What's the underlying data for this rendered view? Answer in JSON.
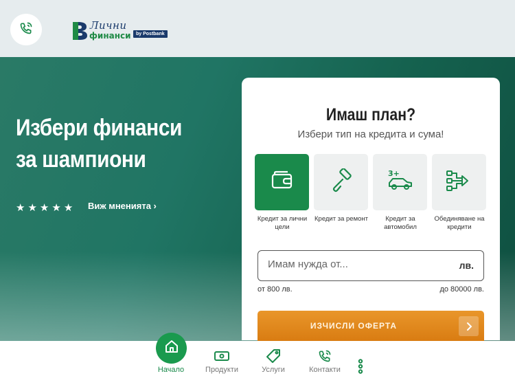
{
  "header": {
    "logo": {
      "line1": "Лични",
      "line2": "финанси",
      "badge": "by Postbank"
    },
    "call_icon": "phone-icon"
  },
  "hero": {
    "title": "Избери финанси за шампиони",
    "rating_stars": 5,
    "reviews_link": "Виж мненията ›"
  },
  "card": {
    "title": "Имаш план?",
    "subtitle": "Избери тип на кредита и сума!",
    "loan_types": [
      {
        "label": "Кредит за лични цели",
        "icon": "wallet-icon",
        "selected": true
      },
      {
        "label": "Кредит за ремонт",
        "icon": "paint-roller-icon",
        "selected": false
      },
      {
        "label": "Кредит за автомобил",
        "icon": "car-icon",
        "selected": false
      },
      {
        "label": "Обединяване на кредити",
        "icon": "merge-icon",
        "selected": false
      }
    ],
    "amount_placeholder": "Имам нужда от...",
    "amount_unit": "лв.",
    "range_min": "от  800 лв.",
    "range_max": "до 80000 лв.",
    "cta_label": "ИЗЧИСЛИ ОФЕРТА"
  },
  "bottom_nav": {
    "items": [
      {
        "label": "Начало",
        "icon": "home-icon",
        "active": true
      },
      {
        "label": "Продукти",
        "icon": "cash-icon",
        "active": false
      },
      {
        "label": "Услуги",
        "icon": "tag-icon",
        "active": false
      },
      {
        "label": "Контакти",
        "icon": "phone-icon",
        "active": false
      }
    ],
    "more_icon": "more-vertical-icon"
  },
  "colors": {
    "brand_green": "#1a8a4b",
    "cta_orange": "#e08620",
    "hero_teal": "#1f7562"
  }
}
